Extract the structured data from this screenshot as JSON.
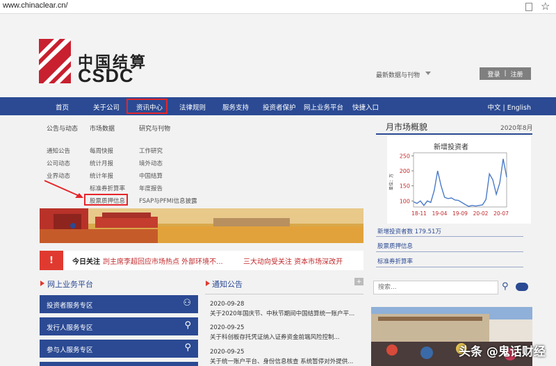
{
  "browser": {
    "url": "www.chinaclear.cn/"
  },
  "header": {
    "logo_cn": "中国结算",
    "logo_en": "CSDC",
    "latest_label": "最新数据与刊物",
    "login": "登录",
    "separator": "|",
    "register": "注册"
  },
  "nav": {
    "items": [
      "首页",
      "关于公司",
      "资讯中心",
      "法律规则",
      "服务支持",
      "投资者保护",
      "网上业务平台",
      "快捷入口"
    ],
    "lang": "中文 | English"
  },
  "dropdown": {
    "columns": [
      {
        "head": "公告与动态",
        "items": [
          "通知公告",
          "公司动态",
          "业界动态"
        ]
      },
      {
        "head": "市场数据",
        "items": [
          "每周快报",
          "统计月报",
          "统计年报",
          "标准券折算率",
          "股票质押信息"
        ]
      },
      {
        "head": "研究与刊物",
        "items": [
          "工作研究",
          "境外动态",
          "中国结算",
          "年度报告",
          "FSAP与PFMI信息披露"
        ]
      }
    ]
  },
  "focus": {
    "flag": "!",
    "label": "今日关注",
    "news1": "剀主席李超回应市场热点 外部环境不...",
    "news2": "三大动向受关注 资本市场深改开"
  },
  "market": {
    "title": "月市场概貌",
    "date": "2020年8月",
    "chart_title": "新增投资者",
    "y_label": "单位：万",
    "stat": "新增投资者数  179.51万",
    "link1": "股票质押信息",
    "link2": "标准券折算率"
  },
  "chart_data": {
    "type": "line",
    "title": "新增投资者",
    "ylabel": "单位：万",
    "x_ticks": [
      "18-11",
      "19-04",
      "19-09",
      "20-02",
      "20-07"
    ],
    "ylim": [
      80,
      260
    ],
    "y_ticks": [
      100,
      150,
      200,
      250
    ],
    "values": [
      97,
      92,
      100,
      85,
      100,
      95,
      135,
      200,
      150,
      112,
      108,
      110,
      103,
      102,
      95,
      88,
      82,
      85,
      83,
      85,
      87,
      105,
      190,
      170,
      122,
      160,
      240,
      179
    ]
  },
  "services": {
    "title": "网上业务平台",
    "buttons": [
      "投资者服务专区",
      "发行人服务专区",
      "参与人服务专区"
    ]
  },
  "notices": {
    "title": "通知公告",
    "plus": "+",
    "items": [
      {
        "date": "2020-09-28",
        "text": "关于2020年国庆节、中秋节期间中国结算统一账户平..."
      },
      {
        "date": "2020-09-25",
        "text": "关于科创板存托凭证纳入证券资金前端风险控制..."
      },
      {
        "date": "2020-09-25",
        "text": "关于统一账户平台、身份信息核查 系统暂停对外提供..."
      }
    ]
  },
  "search": {
    "placeholder": "搜索..."
  },
  "watermark": "头条 @鬼话财经",
  "colors": {
    "nav": "#2b4a93",
    "accent_red": "#e5252a"
  }
}
